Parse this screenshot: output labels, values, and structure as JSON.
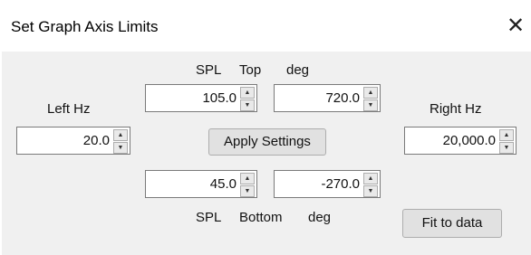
{
  "window": {
    "title": "Set Graph Axis Limits",
    "close_glyph": "✕"
  },
  "labels": {
    "spl_top": "SPL",
    "top": "Top",
    "deg_top": "deg",
    "left_hz": "Left Hz",
    "right_hz": "Right Hz",
    "spl_bottom": "SPL",
    "bottom": "Bottom",
    "deg_bottom": "deg"
  },
  "fields": {
    "spl_top": "105.0",
    "deg_top": "720.0",
    "left_hz": "20.0",
    "right_hz": "20,000.0",
    "spl_bottom": "45.0",
    "deg_bottom": "-270.0"
  },
  "spinner": {
    "up": "▲",
    "down": "▼"
  },
  "buttons": {
    "apply": "Apply Settings",
    "fit": "Fit to data"
  }
}
